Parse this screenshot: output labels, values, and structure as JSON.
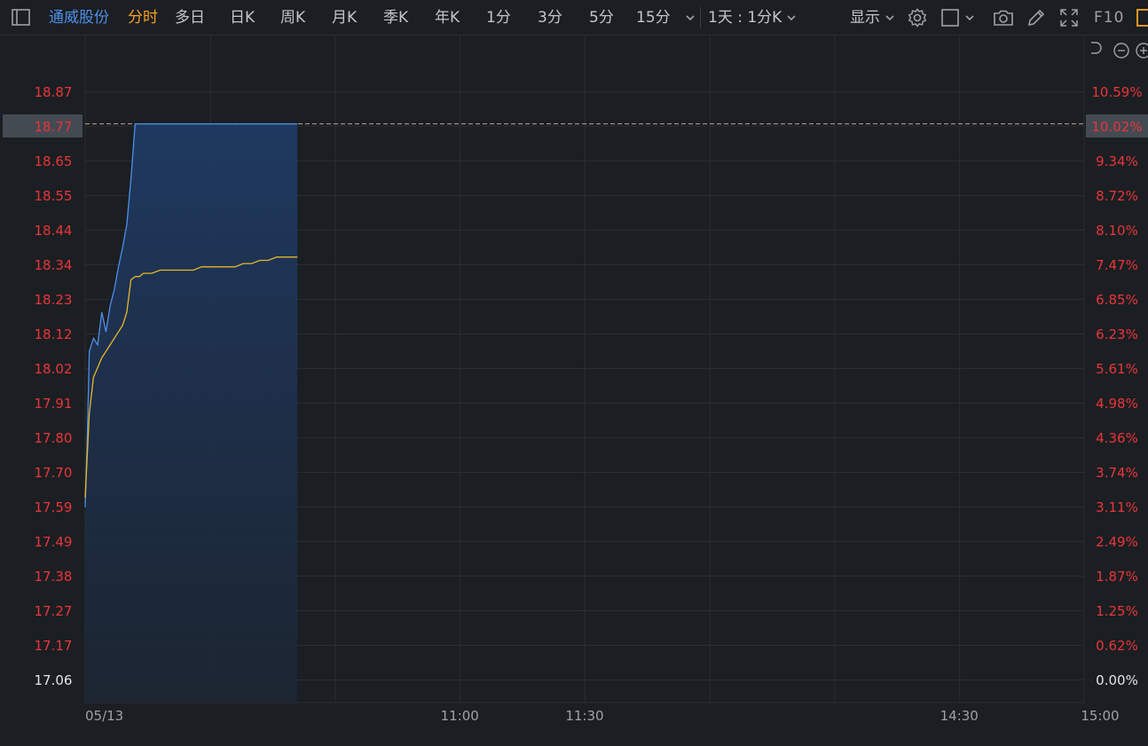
{
  "toolbar": {
    "stock_name": "通威股份",
    "tab_active": "分时",
    "periods": [
      "多日",
      "日K",
      "周K",
      "月K",
      "季K",
      "年K",
      "1分",
      "3分",
      "5分",
      "15分"
    ],
    "range_select": "1天 : 1分K",
    "display_label": "显示",
    "f10_label": "F10",
    "icons": [
      "sidebar-toggle-icon",
      "gear-icon",
      "square-icon",
      "camera-icon",
      "pencil-icon",
      "fullscreen-icon"
    ]
  },
  "colors": {
    "background": "#1b1e22",
    "up_red": "#e8363a",
    "price_line": "#4d8fe8",
    "avg_line": "#e8b62a",
    "active_tab": "#f3a323",
    "stock_name": "#4d8fe8",
    "grid": "#2a2e34"
  },
  "chart_data": {
    "type": "line",
    "title": "",
    "current_price_label": "18.77",
    "current_pct_label": "10.02%",
    "y_left_ticks": [
      "18.87",
      "18.77",
      "18.65",
      "18.55",
      "18.44",
      "18.34",
      "18.23",
      "18.12",
      "18.02",
      "17.91",
      "17.80",
      "17.70",
      "17.59",
      "17.49",
      "17.38",
      "17.27",
      "17.17",
      "17.06"
    ],
    "y_right_ticks": [
      "10.59%",
      "10.02%",
      "9.34%",
      "8.72%",
      "8.10%",
      "7.47%",
      "6.85%",
      "6.23%",
      "5.61%",
      "4.98%",
      "4.36%",
      "3.74%",
      "3.11%",
      "2.49%",
      "1.87%",
      "1.25%",
      "0.62%",
      "0.00%"
    ],
    "ylim": [
      17.06,
      18.87
    ],
    "prev_close": 17.06,
    "limit_price": 18.77,
    "x_labels": [
      {
        "label": "05/13",
        "minute": 0
      },
      {
        "label": "11:00",
        "minute": 90
      },
      {
        "label": "11:30",
        "minute": 120
      },
      {
        "label": "14:30",
        "minute": 210
      },
      {
        "label": "15:00",
        "minute": 240
      }
    ],
    "total_minutes": 240,
    "series": [
      {
        "key": "price",
        "x": [
          0,
          0.5,
          1,
          2,
          3,
          4,
          5,
          6,
          7,
          8,
          9,
          10,
          11,
          12,
          13,
          14,
          15,
          16,
          17,
          18,
          19,
          20,
          21,
          22,
          23,
          24,
          25,
          26,
          27,
          28,
          29,
          30,
          31,
          32,
          33,
          34,
          35,
          36,
          37,
          38,
          39,
          40,
          41,
          42,
          43,
          44,
          45,
          46,
          47,
          48,
          49,
          50,
          51
        ],
        "values": [
          17.59,
          17.8,
          18.07,
          18.11,
          18.09,
          18.19,
          18.13,
          18.21,
          18.26,
          18.33,
          18.39,
          18.46,
          18.6,
          18.77,
          18.77,
          18.77,
          18.77,
          18.77,
          18.77,
          18.77,
          18.77,
          18.77,
          18.77,
          18.77,
          18.77,
          18.77,
          18.77,
          18.77,
          18.77,
          18.77,
          18.77,
          18.77,
          18.77,
          18.77,
          18.77,
          18.77,
          18.77,
          18.77,
          18.77,
          18.77,
          18.77,
          18.77,
          18.77,
          18.77,
          18.77,
          18.77,
          18.77,
          18.77,
          18.77,
          18.77,
          18.77,
          18.77,
          18.77
        ]
      },
      {
        "key": "average",
        "x": [
          0,
          1,
          2,
          3,
          4,
          5,
          6,
          7,
          8,
          9,
          10,
          11,
          12,
          13,
          14,
          16,
          18,
          20,
          22,
          24,
          26,
          28,
          30,
          32,
          34,
          36,
          38,
          40,
          42,
          44,
          46,
          48,
          50,
          51
        ],
        "values": [
          17.62,
          17.88,
          17.99,
          18.02,
          18.05,
          18.07,
          18.09,
          18.11,
          18.13,
          18.15,
          18.19,
          18.29,
          18.3,
          18.3,
          18.31,
          18.31,
          18.32,
          18.32,
          18.32,
          18.32,
          18.32,
          18.33,
          18.33,
          18.33,
          18.33,
          18.33,
          18.34,
          18.34,
          18.35,
          18.35,
          18.36,
          18.36,
          18.36,
          18.36
        ]
      }
    ]
  }
}
